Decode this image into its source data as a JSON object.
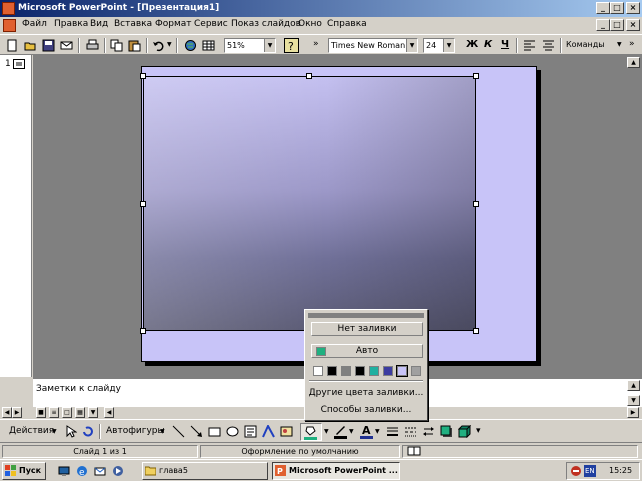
{
  "window": {
    "title": "Microsoft PowerPoint - [Презентация1]",
    "controls": [
      "_",
      "□",
      "×"
    ],
    "doc_controls": [
      "_",
      "□",
      "×"
    ]
  },
  "menu": [
    "Файл",
    "Правка",
    "Вид",
    "Вставка",
    "Формат",
    "Сервис",
    "Показ слайдов",
    "Окно",
    "Справка"
  ],
  "standard_toolbar": {
    "zoom": "51%",
    "font_name": "Times New Roman",
    "font_size": "24",
    "bold": "Ж",
    "italic": "К",
    "underline": "Ч",
    "commands": "Команды"
  },
  "outline": {
    "slide_number": "1"
  },
  "notes": {
    "placeholder": "Заметки к слайду"
  },
  "drawing_toolbar": {
    "actions": "Действия",
    "autoshapes": "Автофигуры"
  },
  "status": {
    "slide": "Слайд 1 из 1",
    "design": "Оформление по умолчанию"
  },
  "fill_popup": {
    "no_fill": "Нет заливки",
    "auto": "Авто",
    "auto_color": "#20b080",
    "swatches": [
      "#ffffff",
      "#000000",
      "#808080",
      "#000000",
      "#20b0a0",
      "#3c3ca0",
      "#c8c4f8",
      "#a0a0a0"
    ],
    "more_colors": "Другие цвета заливки...",
    "fill_effects": "Способы заливки..."
  },
  "taskbar": {
    "start": "Пуск",
    "folder_item": "глава5",
    "app_item": "Microsoft PowerPoint ...",
    "lang": "EN",
    "clock": "15:25"
  },
  "colors": {
    "title_bar": "#0a246a",
    "slide_bg": "#c8c4f8",
    "workspace": "#808080"
  }
}
